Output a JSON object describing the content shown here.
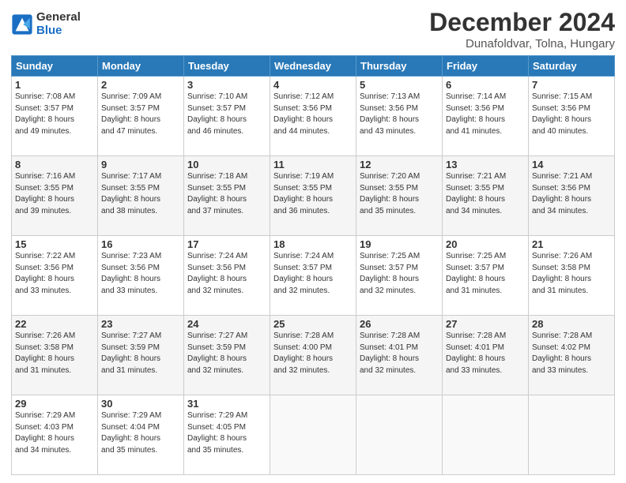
{
  "header": {
    "logo_line1": "General",
    "logo_line2": "Blue",
    "title": "December 2024",
    "subtitle": "Dunafoldvar, Tolna, Hungary"
  },
  "calendar": {
    "headers": [
      "Sunday",
      "Monday",
      "Tuesday",
      "Wednesday",
      "Thursday",
      "Friday",
      "Saturday"
    ],
    "rows": [
      [
        {
          "day": "1",
          "info": "Sunrise: 7:08 AM\nSunset: 3:57 PM\nDaylight: 8 hours\nand 49 minutes."
        },
        {
          "day": "2",
          "info": "Sunrise: 7:09 AM\nSunset: 3:57 PM\nDaylight: 8 hours\nand 47 minutes."
        },
        {
          "day": "3",
          "info": "Sunrise: 7:10 AM\nSunset: 3:57 PM\nDaylight: 8 hours\nand 46 minutes."
        },
        {
          "day": "4",
          "info": "Sunrise: 7:12 AM\nSunset: 3:56 PM\nDaylight: 8 hours\nand 44 minutes."
        },
        {
          "day": "5",
          "info": "Sunrise: 7:13 AM\nSunset: 3:56 PM\nDaylight: 8 hours\nand 43 minutes."
        },
        {
          "day": "6",
          "info": "Sunrise: 7:14 AM\nSunset: 3:56 PM\nDaylight: 8 hours\nand 41 minutes."
        },
        {
          "day": "7",
          "info": "Sunrise: 7:15 AM\nSunset: 3:56 PM\nDaylight: 8 hours\nand 40 minutes."
        }
      ],
      [
        {
          "day": "8",
          "info": "Sunrise: 7:16 AM\nSunset: 3:55 PM\nDaylight: 8 hours\nand 39 minutes."
        },
        {
          "day": "9",
          "info": "Sunrise: 7:17 AM\nSunset: 3:55 PM\nDaylight: 8 hours\nand 38 minutes."
        },
        {
          "day": "10",
          "info": "Sunrise: 7:18 AM\nSunset: 3:55 PM\nDaylight: 8 hours\nand 37 minutes."
        },
        {
          "day": "11",
          "info": "Sunrise: 7:19 AM\nSunset: 3:55 PM\nDaylight: 8 hours\nand 36 minutes."
        },
        {
          "day": "12",
          "info": "Sunrise: 7:20 AM\nSunset: 3:55 PM\nDaylight: 8 hours\nand 35 minutes."
        },
        {
          "day": "13",
          "info": "Sunrise: 7:21 AM\nSunset: 3:55 PM\nDaylight: 8 hours\nand 34 minutes."
        },
        {
          "day": "14",
          "info": "Sunrise: 7:21 AM\nSunset: 3:56 PM\nDaylight: 8 hours\nand 34 minutes."
        }
      ],
      [
        {
          "day": "15",
          "info": "Sunrise: 7:22 AM\nSunset: 3:56 PM\nDaylight: 8 hours\nand 33 minutes."
        },
        {
          "day": "16",
          "info": "Sunrise: 7:23 AM\nSunset: 3:56 PM\nDaylight: 8 hours\nand 33 minutes."
        },
        {
          "day": "17",
          "info": "Sunrise: 7:24 AM\nSunset: 3:56 PM\nDaylight: 8 hours\nand 32 minutes."
        },
        {
          "day": "18",
          "info": "Sunrise: 7:24 AM\nSunset: 3:57 PM\nDaylight: 8 hours\nand 32 minutes."
        },
        {
          "day": "19",
          "info": "Sunrise: 7:25 AM\nSunset: 3:57 PM\nDaylight: 8 hours\nand 32 minutes."
        },
        {
          "day": "20",
          "info": "Sunrise: 7:25 AM\nSunset: 3:57 PM\nDaylight: 8 hours\nand 31 minutes."
        },
        {
          "day": "21",
          "info": "Sunrise: 7:26 AM\nSunset: 3:58 PM\nDaylight: 8 hours\nand 31 minutes."
        }
      ],
      [
        {
          "day": "22",
          "info": "Sunrise: 7:26 AM\nSunset: 3:58 PM\nDaylight: 8 hours\nand 31 minutes."
        },
        {
          "day": "23",
          "info": "Sunrise: 7:27 AM\nSunset: 3:59 PM\nDaylight: 8 hours\nand 31 minutes."
        },
        {
          "day": "24",
          "info": "Sunrise: 7:27 AM\nSunset: 3:59 PM\nDaylight: 8 hours\nand 32 minutes."
        },
        {
          "day": "25",
          "info": "Sunrise: 7:28 AM\nSunset: 4:00 PM\nDaylight: 8 hours\nand 32 minutes."
        },
        {
          "day": "26",
          "info": "Sunrise: 7:28 AM\nSunset: 4:01 PM\nDaylight: 8 hours\nand 32 minutes."
        },
        {
          "day": "27",
          "info": "Sunrise: 7:28 AM\nSunset: 4:01 PM\nDaylight: 8 hours\nand 33 minutes."
        },
        {
          "day": "28",
          "info": "Sunrise: 7:28 AM\nSunset: 4:02 PM\nDaylight: 8 hours\nand 33 minutes."
        }
      ],
      [
        {
          "day": "29",
          "info": "Sunrise: 7:29 AM\nSunset: 4:03 PM\nDaylight: 8 hours\nand 34 minutes."
        },
        {
          "day": "30",
          "info": "Sunrise: 7:29 AM\nSunset: 4:04 PM\nDaylight: 8 hours\nand 35 minutes."
        },
        {
          "day": "31",
          "info": "Sunrise: 7:29 AM\nSunset: 4:05 PM\nDaylight: 8 hours\nand 35 minutes."
        },
        {
          "day": "",
          "info": ""
        },
        {
          "day": "",
          "info": ""
        },
        {
          "day": "",
          "info": ""
        },
        {
          "day": "",
          "info": ""
        }
      ]
    ]
  }
}
